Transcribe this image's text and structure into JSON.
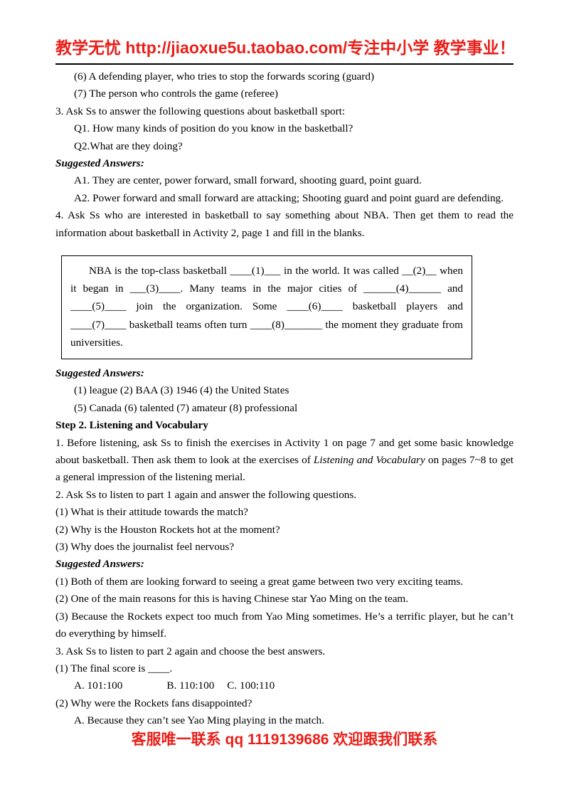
{
  "header": {
    "banner_text": "教学无忧 http://jiaoxue5u.taobao.com/专注中小学  教学事业！",
    "banner_color": "#E8201A"
  },
  "footer": {
    "banner_text": "客服唯一联系 qq   1119139686 欢迎跟我们联系",
    "banner_color": "#E8201A"
  },
  "body_top": {
    "line_6": "(6) A defending player, who tries to stop the forwards scoring (guard)",
    "line_7": "(7) The person who controls the game (referee)",
    "item_3": "3. Ask Ss to answer the following questions about basketball sport:",
    "q1": "Q1. How many kinds of position do you know in the basketball?",
    "q2": "Q2.What are they doing?",
    "suggested_answers_label": "Suggested Answers:",
    "a1": "A1. They are center, power forward, small forward, shooting guard, point guard.",
    "a2": "A2. Power forward and small forward are attacking; Shooting guard and point guard are defending.",
    "item_4": "4. Ask Ss who are interested in basketball to say something about NBA. Then get them to read the information about basketball in Activity 2, page 1 and fill in the blanks."
  },
  "passage": {
    "para1": "NBA is the top-class basketball ____(1)___ in the world. It was called __(2)__ when it began in ___(3)____. Many teams in the major cities of ______(4)______ and ____(5)____ join the organization. Some ____(6)____ basketball players and ____(7)____ basketball teams often turn ____(8)_______ the moment they graduate from universities."
  },
  "answers_block": {
    "suggested_answers_label": "Suggested Answers:",
    "line_1": "(1)  league (2) BAA (3) 1946 (4) the United States",
    "line_2": "(5) Canada (6) talented (7) amateur (8) professional"
  },
  "step2": {
    "heading": "Step 2. Listening and Vocabulary",
    "item_1_part_a": "1. Before listening, ask Ss to finish the exercises in Activity 1 on page 7 and get some basic knowledge about basketball. Then ask them to look at the exercises of ",
    "item_1_italic": "Listening and Vocabulary",
    "item_1_part_b": " on pages 7~8 to get a general impression of the listening merial.",
    "item_2": "2. Ask Ss to listen to part 1 again and answer the following questions.",
    "q1": "(1) What is their attitude towards the match?",
    "q2": "(2) Why is the Houston Rockets hot at the moment?",
    "q3": "(3) Why does the journalist feel nervous?",
    "suggested_answers_label": "Suggested Answers:",
    "a1": "(1) Both of them are looking forward to seeing a great game between two very exciting teams.",
    "a2": "(2) One of the main reasons for this is having Chinese star Yao Ming on the team.",
    "a3": "(3) Because the Rockets expect too much from Yao Ming sometimes. He’s a terrific player, but he can’t do everything by himself.",
    "item_3": "3. Ask Ss to listen to part 2 again and choose the best answers.",
    "mc1_stem": "(1) The final score is ____.",
    "mc1_option_a": "A. 101:100",
    "mc1_option_b": "B. 110:100",
    "mc1_option_c": "C. 100:110",
    "mc2_stem": "(2) Why were the Rockets fans disappointed?",
    "mc2_option_a": "A. Because they can’t see Yao Ming playing in the match."
  }
}
